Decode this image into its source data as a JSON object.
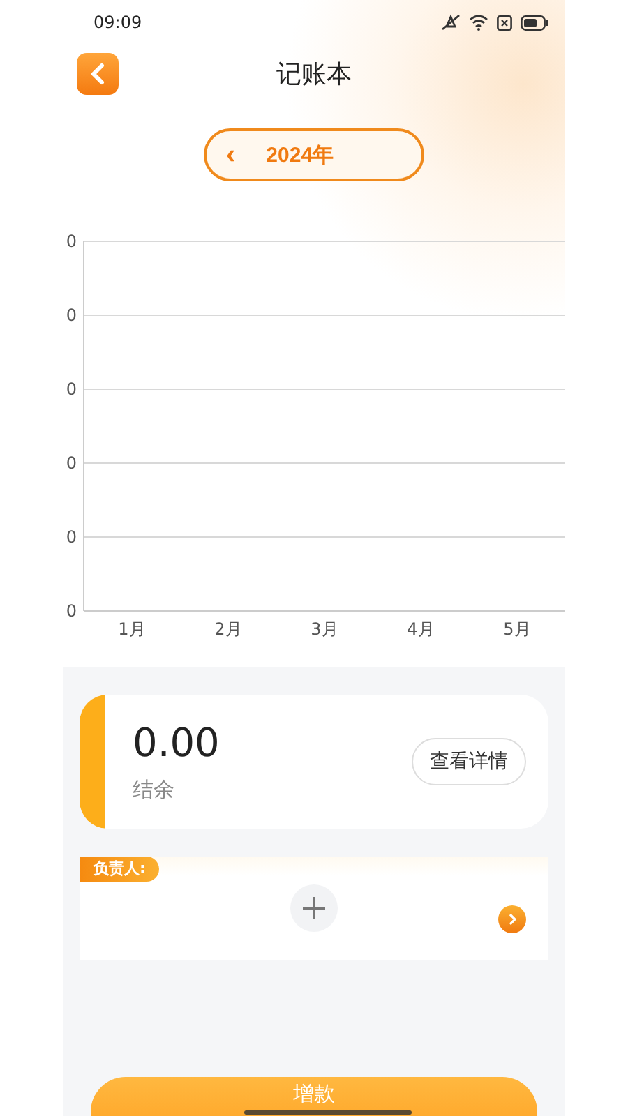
{
  "status_bar": {
    "time": "09:09"
  },
  "header": {
    "title": "记账本"
  },
  "year_picker": {
    "prev": "‹",
    "label": "2024年"
  },
  "chart": {
    "y_labels": [
      "0",
      "0",
      "0",
      "0",
      "0",
      "0"
    ],
    "x_labels": [
      "1月",
      "2月",
      "3月",
      "4月",
      "5月"
    ]
  },
  "balance": {
    "amount": "0.00",
    "label": "结余",
    "button": "查看详情"
  },
  "owner": {
    "tag": "负责人:"
  },
  "bottom_button": "增款"
}
